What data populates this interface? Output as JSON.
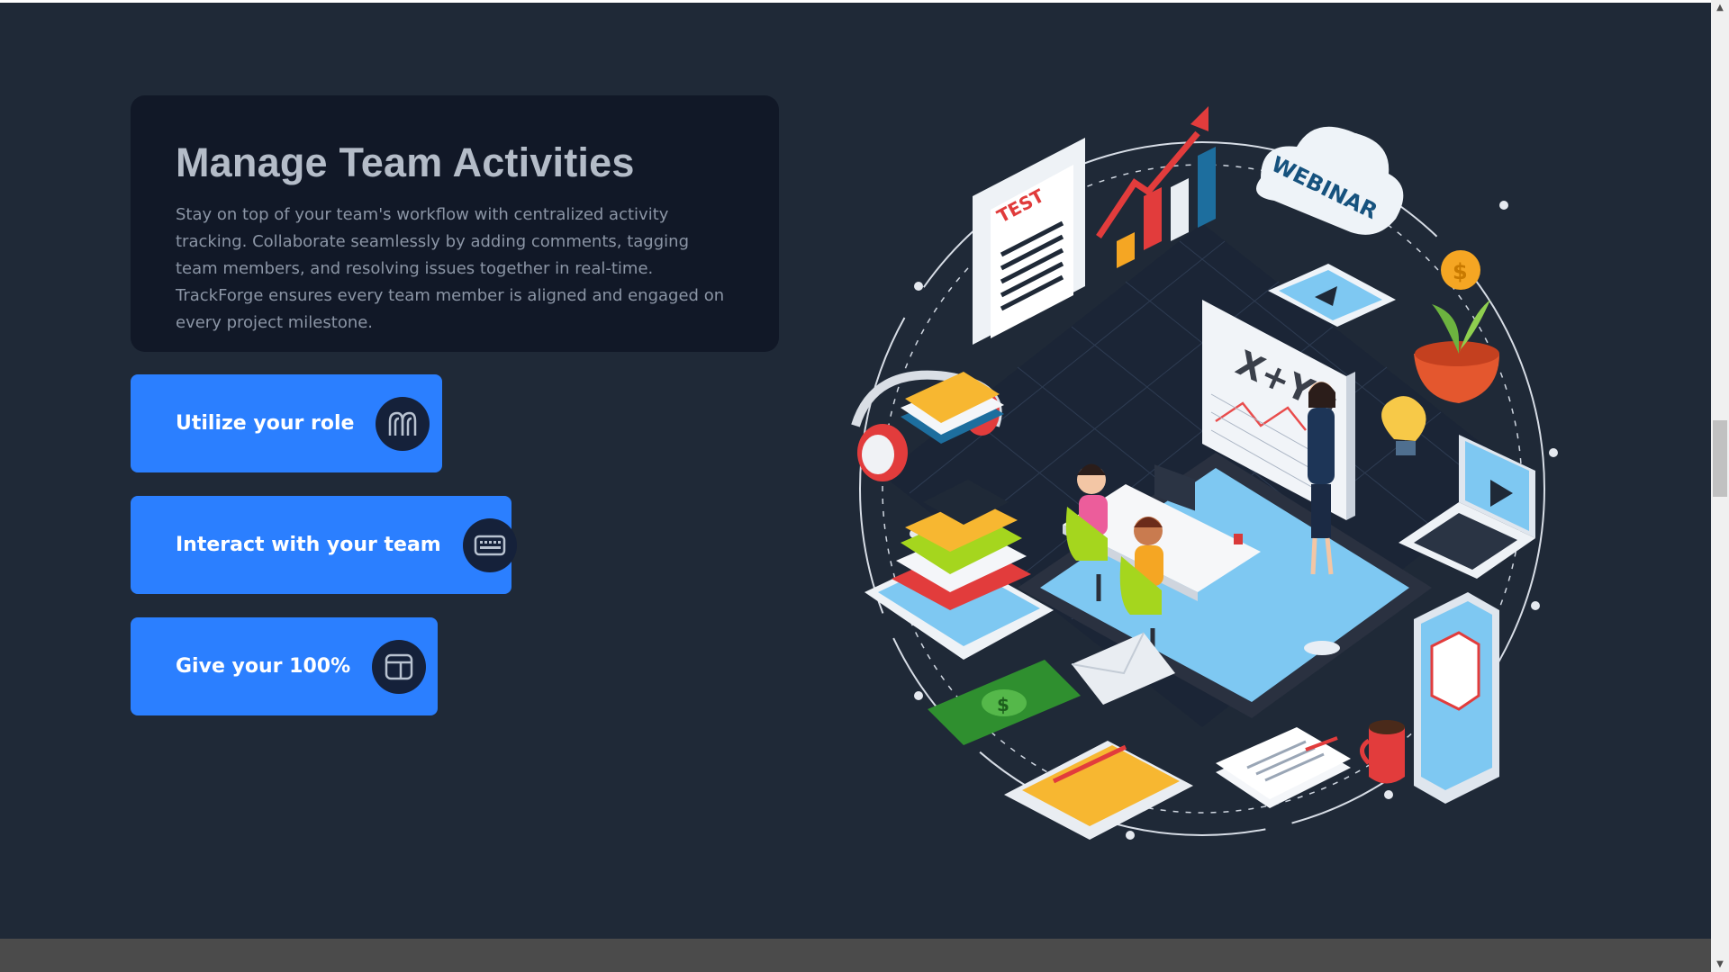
{
  "hero": {
    "title": "Manage Team Activities",
    "description": "Stay on top of your team's workflow with centralized activity tracking. Collaborate seamlessly by adding comments, tagging team members, and resolving issues together in real-time. TrackForge ensures every team member is aligned and engaged on every project milestone."
  },
  "actions": [
    {
      "label": "Utilize your role",
      "icon": "arches-icon"
    },
    {
      "label": "Interact with your team",
      "icon": "keyboard-icon"
    },
    {
      "label": "Give your 100%",
      "icon": "layout-icon"
    }
  ],
  "illustration": {
    "texts": {
      "test": "TEST",
      "webinar": "WEBINAR",
      "formula": "X+Y="
    }
  },
  "colors": {
    "page_bg": "#1f2937",
    "card_bg": "#111827",
    "button_bg": "#2b7fff",
    "icon_circle": "#15213a"
  }
}
